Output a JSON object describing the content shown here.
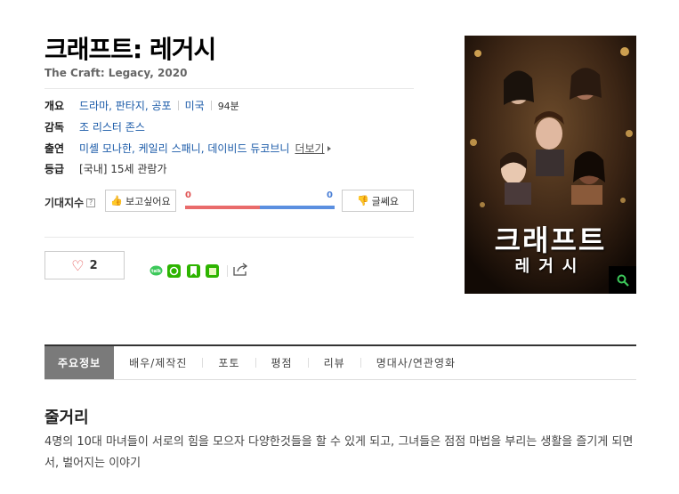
{
  "movie": {
    "title": "크래프트: 레거시",
    "original_title": "The Craft: Legacy, 2020"
  },
  "info": {
    "overview_label": "개요",
    "genres": "드라마, 판타지, 공포",
    "country": "미국",
    "runtime": "94분",
    "director_label": "감독",
    "director": "조 리스터 존스",
    "cast_label": "출연",
    "cast": "미셸 모나한, 케일리 스패니, 데이비드 듀코브니",
    "more_label": "더보기",
    "rating_label": "등급",
    "rating": "[국내] 15세 관람가"
  },
  "expectation": {
    "label": "기대지수",
    "help": "?",
    "want_label": "보고싶어요",
    "want_count": "0",
    "nowant_label": "글쎄요",
    "nowant_count": "0"
  },
  "like": {
    "count": "2"
  },
  "poster": {
    "title": "크래프트",
    "subtitle": "레거시",
    "zoom_icon": "search-icon"
  },
  "tabs": [
    {
      "label": "주요정보"
    },
    {
      "label": "배우/제작진"
    },
    {
      "label": "포토"
    },
    {
      "label": "평점"
    },
    {
      "label": "리뷰"
    },
    {
      "label": "명대사/연관영화"
    }
  ],
  "synopsis": {
    "heading": "줄거리",
    "text": "4명의 10대 마녀들이 서로의 힘을 모으자 다양한것들을 할 수 있게 되고, 그녀들은 점점 마법을 부리는 생활을 즐기게 되면서, 벌어지는 이야기"
  },
  "colors": {
    "accent_red": "#e96b6b",
    "accent_blue": "#5b8fe0",
    "link": "#1a5aa8",
    "active_tab": "#7a7a7a"
  }
}
